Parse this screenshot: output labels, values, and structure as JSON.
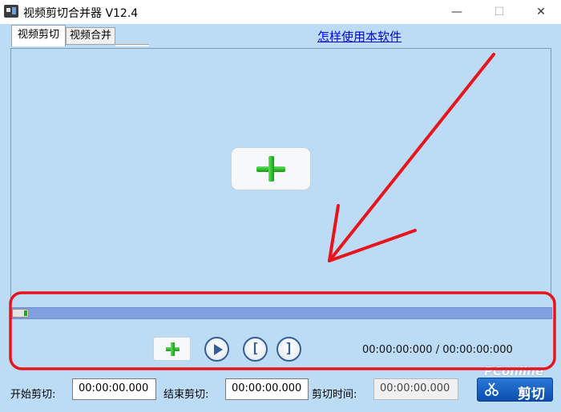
{
  "window": {
    "title": "视频剪切合并器 V12.4",
    "min_icon": "minimize-icon",
    "max_icon": "maximize-icon",
    "close_icon": "close-icon",
    "min_glyph": "—",
    "max_glyph": "☐",
    "close_glyph": "✕"
  },
  "tabs": [
    {
      "label": "视频剪切",
      "active": true
    },
    {
      "label": "视频合并",
      "active": false
    }
  ],
  "help_link": "怎样使用本软件",
  "video_pane": {
    "add_icon": "plus-icon"
  },
  "timeline": {
    "position": 0.0
  },
  "controls": {
    "add_icon": "plus-icon",
    "play_icon": "play-icon",
    "mark_in_glyph": "[",
    "mark_out_glyph": "]",
    "time_readout": "00:00:00:000 / 00:00:00:000"
  },
  "bottom": {
    "start_label": "开始剪切:",
    "start_value": "00:00:00.000",
    "end_label": "结束剪切:",
    "end_value": "00:00:00.000",
    "duration_label": "剪切时间:",
    "duration_value": "00:00:00.000",
    "cut_button": "剪切"
  },
  "watermark": "PConline",
  "colors": {
    "background": "#bcdcf6",
    "annotation": "#e8141c",
    "timeline": "#7f9fde",
    "accent": "#355f95",
    "cut_button": "#1a5fc0"
  }
}
